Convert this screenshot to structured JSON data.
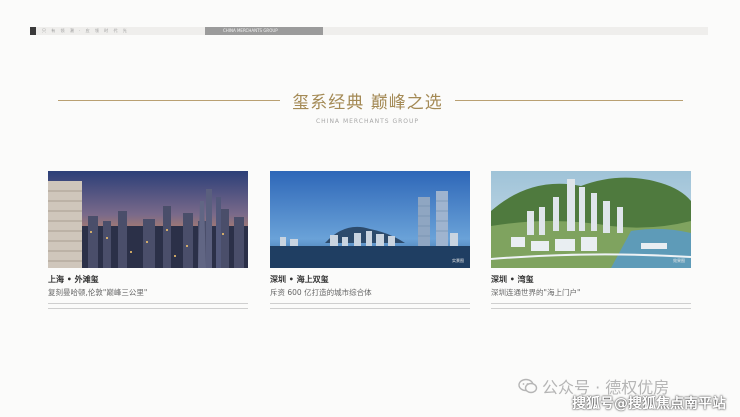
{
  "topbar": {
    "left_text": "只 有 领 潮 · 应 领 时 代 光",
    "tag_text": "CHINA MERCHANTS GROUP"
  },
  "heading": {
    "title": "玺系经典  巅峰之选",
    "subtitle": "CHINA MERCHANTS GROUP"
  },
  "cards": [
    {
      "name": "上海 • 外滩玺",
      "desc": "复刻曼哈顿,伦敦\"巅峰三公里\"",
      "badge": ""
    },
    {
      "name": "深圳 • 海上双玺",
      "desc": "斥资 600 亿打造的城市综合体",
      "badge": "实景图"
    },
    {
      "name": "深圳 • 湾玺",
      "desc": "深圳连通世界的\"海上门户\"",
      "badge": "效果图"
    }
  ],
  "watermarks": {
    "wechat": "公众号 · 德权优房",
    "sohu": "搜狐号@搜狐焦点南平站"
  },
  "colors": {
    "accent_gold": "#a48a55",
    "rule_gold": "#b9a072"
  }
}
